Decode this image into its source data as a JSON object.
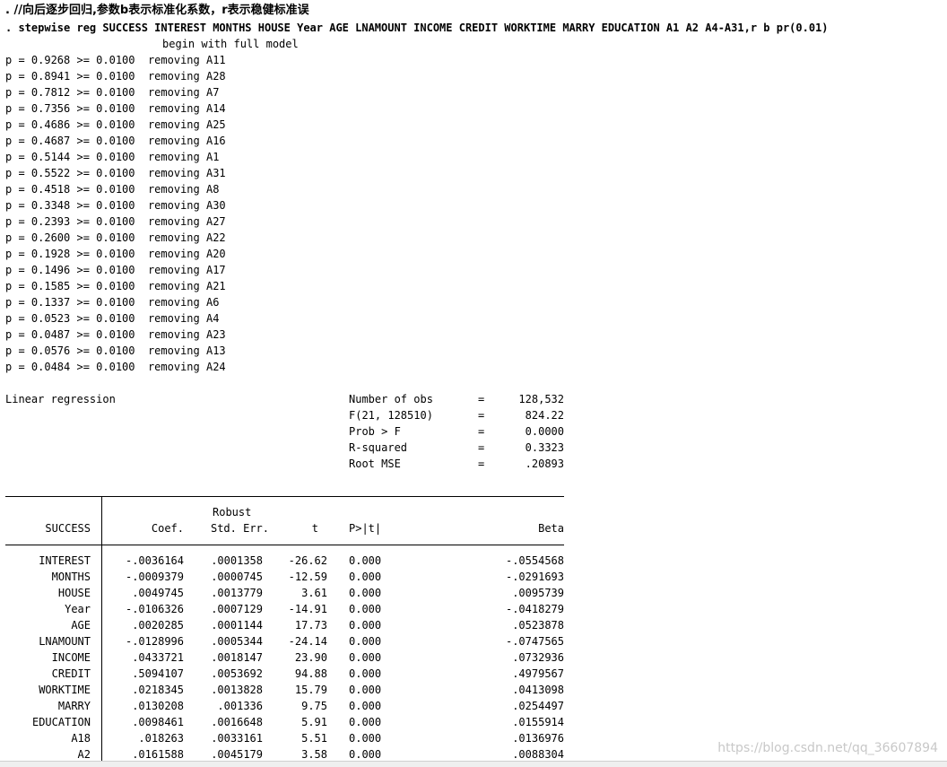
{
  "header": {
    "comment": ". //向后逐步回归,参数b表示标准化系数，r表示稳健标准误",
    "command": ". stepwise reg SUCCESS INTEREST MONTHS HOUSE Year AGE LNAMOUNT INCOME CREDIT WORKTIME MARRY EDUCATION A1 A2 A4-A31,r b pr(0.01)",
    "begin_msg": "begin with full model"
  },
  "removal_steps": [
    {
      "p": "0.9268",
      "threshold": "0.0100",
      "var": "A11"
    },
    {
      "p": "0.8941",
      "threshold": "0.0100",
      "var": "A28"
    },
    {
      "p": "0.7812",
      "threshold": "0.0100",
      "var": "A7"
    },
    {
      "p": "0.7356",
      "threshold": "0.0100",
      "var": "A14"
    },
    {
      "p": "0.4686",
      "threshold": "0.0100",
      "var": "A25"
    },
    {
      "p": "0.4687",
      "threshold": "0.0100",
      "var": "A16"
    },
    {
      "p": "0.5144",
      "threshold": "0.0100",
      "var": "A1"
    },
    {
      "p": "0.5522",
      "threshold": "0.0100",
      "var": "A31"
    },
    {
      "p": "0.4518",
      "threshold": "0.0100",
      "var": "A8"
    },
    {
      "p": "0.3348",
      "threshold": "0.0100",
      "var": "A30"
    },
    {
      "p": "0.2393",
      "threshold": "0.0100",
      "var": "A27"
    },
    {
      "p": "0.2600",
      "threshold": "0.0100",
      "var": "A22"
    },
    {
      "p": "0.1928",
      "threshold": "0.0100",
      "var": "A20"
    },
    {
      "p": "0.1496",
      "threshold": "0.0100",
      "var": "A17"
    },
    {
      "p": "0.1585",
      "threshold": "0.0100",
      "var": "A21"
    },
    {
      "p": "0.1337",
      "threshold": "0.0100",
      "var": "A6"
    },
    {
      "p": "0.0523",
      "threshold": "0.0100",
      "var": "A4"
    },
    {
      "p": "0.0487",
      "threshold": "0.0100",
      "var": "A23"
    },
    {
      "p": "0.0576",
      "threshold": "0.0100",
      "var": "A13"
    },
    {
      "p": "0.0484",
      "threshold": "0.0100",
      "var": "A24"
    }
  ],
  "regression": {
    "title": "Linear regression",
    "stats": [
      {
        "label": "Number of obs",
        "eq": "=",
        "value": "128,532"
      },
      {
        "label": "F(21, 128510)",
        "eq": "=",
        "value": "824.22"
      },
      {
        "label": "Prob > F",
        "eq": "=",
        "value": "0.0000"
      },
      {
        "label": "R-squared",
        "eq": "=",
        "value": "0.3323"
      },
      {
        "label": "Root MSE",
        "eq": "=",
        "value": ".20893"
      }
    ]
  },
  "table": {
    "depvar": "SUCCESS",
    "robust_label": "Robust",
    "headers": {
      "coef": "Coef.",
      "se": "Std. Err.",
      "t": "t",
      "p": "P>|t|",
      "beta": "Beta"
    },
    "rows": [
      {
        "var": "INTEREST",
        "coef": "-.0036164",
        "se": ".0001358",
        "t": "-26.62",
        "p": "0.000",
        "beta": "-.0554568"
      },
      {
        "var": "MONTHS",
        "coef": "-.0009379",
        "se": ".0000745",
        "t": "-12.59",
        "p": "0.000",
        "beta": "-.0291693"
      },
      {
        "var": "HOUSE",
        "coef": ".0049745",
        "se": ".0013779",
        "t": "3.61",
        "p": "0.000",
        "beta": ".0095739"
      },
      {
        "var": "Year",
        "coef": "-.0106326",
        "se": ".0007129",
        "t": "-14.91",
        "p": "0.000",
        "beta": "-.0418279"
      },
      {
        "var": "AGE",
        "coef": ".0020285",
        "se": ".0001144",
        "t": "17.73",
        "p": "0.000",
        "beta": ".0523878"
      },
      {
        "var": "LNAMOUNT",
        "coef": "-.0128996",
        "se": ".0005344",
        "t": "-24.14",
        "p": "0.000",
        "beta": "-.0747565"
      },
      {
        "var": "INCOME",
        "coef": ".0433721",
        "se": ".0018147",
        "t": "23.90",
        "p": "0.000",
        "beta": ".0732936"
      },
      {
        "var": "CREDIT",
        "coef": ".5094107",
        "se": ".0053692",
        "t": "94.88",
        "p": "0.000",
        "beta": ".4979567"
      },
      {
        "var": "WORKTIME",
        "coef": ".0218345",
        "se": ".0013828",
        "t": "15.79",
        "p": "0.000",
        "beta": ".0413098"
      },
      {
        "var": "MARRY",
        "coef": ".0130208",
        "se": ".001336",
        "t": "9.75",
        "p": "0.000",
        "beta": ".0254497"
      },
      {
        "var": "EDUCATION",
        "coef": ".0098461",
        "se": ".0016648",
        "t": "5.91",
        "p": "0.000",
        "beta": ".0155914"
      },
      {
        "var": "A18",
        "coef": ".018263",
        "se": ".0033161",
        "t": "5.51",
        "p": "0.000",
        "beta": ".0136976"
      },
      {
        "var": "A2",
        "coef": ".0161588",
        "se": ".0045179",
        "t": "3.58",
        "p": "0.000",
        "beta": ".0088304"
      }
    ]
  },
  "watermark": "https://blog.csdn.net/qq_36607894"
}
